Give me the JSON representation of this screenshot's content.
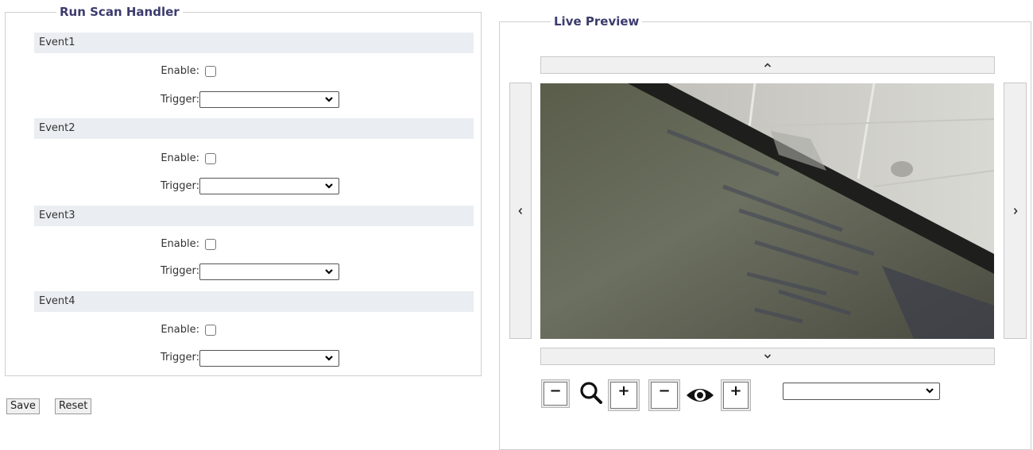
{
  "run_scan_handler": {
    "title": "Run Scan Handler",
    "events": [
      {
        "name": "Event1",
        "enable_label": "Enable:",
        "trigger_label": "Trigger:",
        "enabled": false,
        "trigger_value": ""
      },
      {
        "name": "Event2",
        "enable_label": "Enable:",
        "trigger_label": "Trigger:",
        "enabled": false,
        "trigger_value": ""
      },
      {
        "name": "Event3",
        "enable_label": "Enable:",
        "trigger_label": "Trigger:",
        "enabled": false,
        "trigger_value": ""
      },
      {
        "name": "Event4",
        "enable_label": "Enable:",
        "trigger_label": "Trigger:",
        "enabled": false,
        "trigger_value": ""
      }
    ]
  },
  "actions": {
    "save_label": "Save",
    "reset_label": "Reset"
  },
  "live_preview": {
    "title": "Live Preview",
    "pan_up_icon": "chevron-up-icon",
    "pan_down_icon": "chevron-down-icon",
    "pan_left_icon": "chevron-left-icon",
    "pan_right_icon": "chevron-right-icon",
    "controls": {
      "zoom_out_label": "−",
      "zoom_in_label": "+",
      "zoom_icon": "magnifier-icon",
      "focus_out_label": "−",
      "focus_in_label": "+",
      "focus_icon": "eye-icon",
      "preset_value": ""
    }
  },
  "colors": {
    "legend": "#3b3b6d",
    "event_header_bg": "#eaeef2",
    "border": "#cfcfcf"
  }
}
